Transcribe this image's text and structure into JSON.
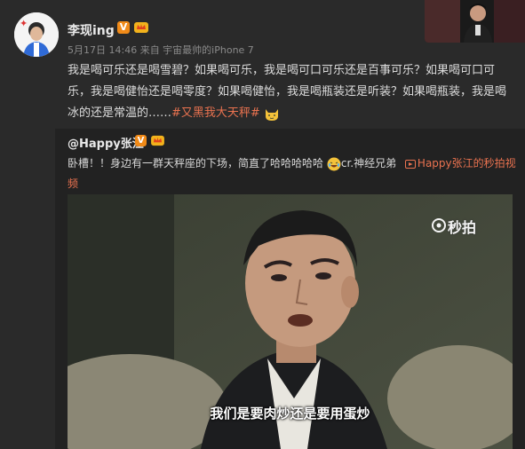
{
  "post": {
    "username": "李现ing",
    "verified_badge": "V",
    "meta": "5月17日 14:46 来自 宇宙最帅的iPhone 7",
    "text_main": "我是喝可乐还是喝雪碧？如果喝可乐，我是喝可口可乐还是百事可乐？如果喝可口可乐，我是喝健怡还是喝零度？如果喝健怡，我是喝瓶装还是听装？如果喝瓶装，我是喝冰的还是常温的……",
    "hashtag": "#又黑我大天秤#",
    "icons": {
      "avatar": "avatar",
      "crown": "crown-icon",
      "cat_emoji": "cat-face-icon"
    }
  },
  "repost": {
    "username": "@Happy张江",
    "verified_badge": "V",
    "text": "卧槽！！身边有一群天秤座的下场，简直了哈哈哈哈哈",
    "mention": "cr.神经兄弟",
    "video_link": "Happy张江的秒拍视频",
    "video": {
      "subtitle": "我们是要肉炒还是要用蛋炒",
      "watermark": "秒拍"
    }
  },
  "colors": {
    "accent": "#eb7350",
    "background": "#2a2a2a",
    "repost_bg": "#222222",
    "badge": "#f08a18"
  }
}
